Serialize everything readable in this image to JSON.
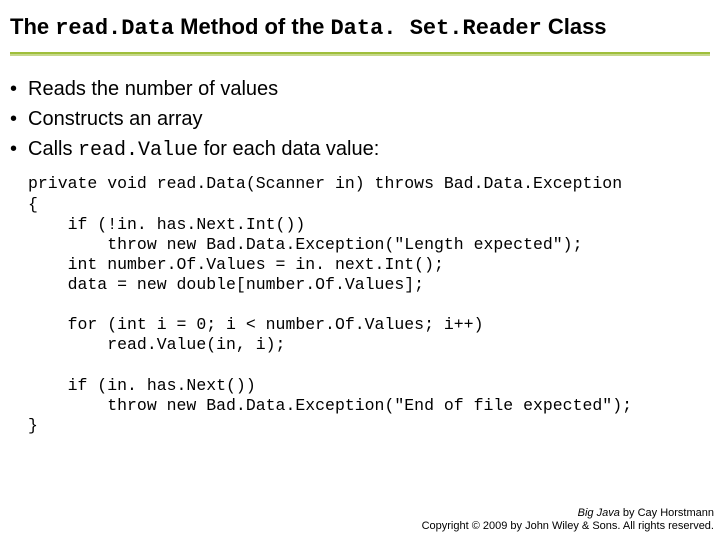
{
  "title": {
    "pre": "The ",
    "method": "read.Data",
    "mid": " Method of the ",
    "class": "Data. Set.Reader",
    "post": " Class"
  },
  "bullets": {
    "b1": "Reads the number of values",
    "b2": "Constructs an array",
    "b3_pre": "Calls ",
    "b3_code": "read.Value",
    "b3_post": " for each data value:"
  },
  "code": "private void read.Data(Scanner in) throws Bad.Data.Exception\n{\n    if (!in. has.Next.Int())\n        throw new Bad.Data.Exception(\"Length expected\");\n    int number.Of.Values = in. next.Int();\n    data = new double[number.Of.Values];\n\n    for (int i = 0; i < number.Of.Values; i++)\n        read.Value(in, i);\n\n    if (in. has.Next())\n        throw new Bad.Data.Exception(\"End of file expected\");\n}",
  "footer": {
    "book": "Big Java",
    "by": " by Cay Horstmann",
    "copyright": "Copyright © 2009 by John Wiley & Sons.  All rights reserved."
  }
}
